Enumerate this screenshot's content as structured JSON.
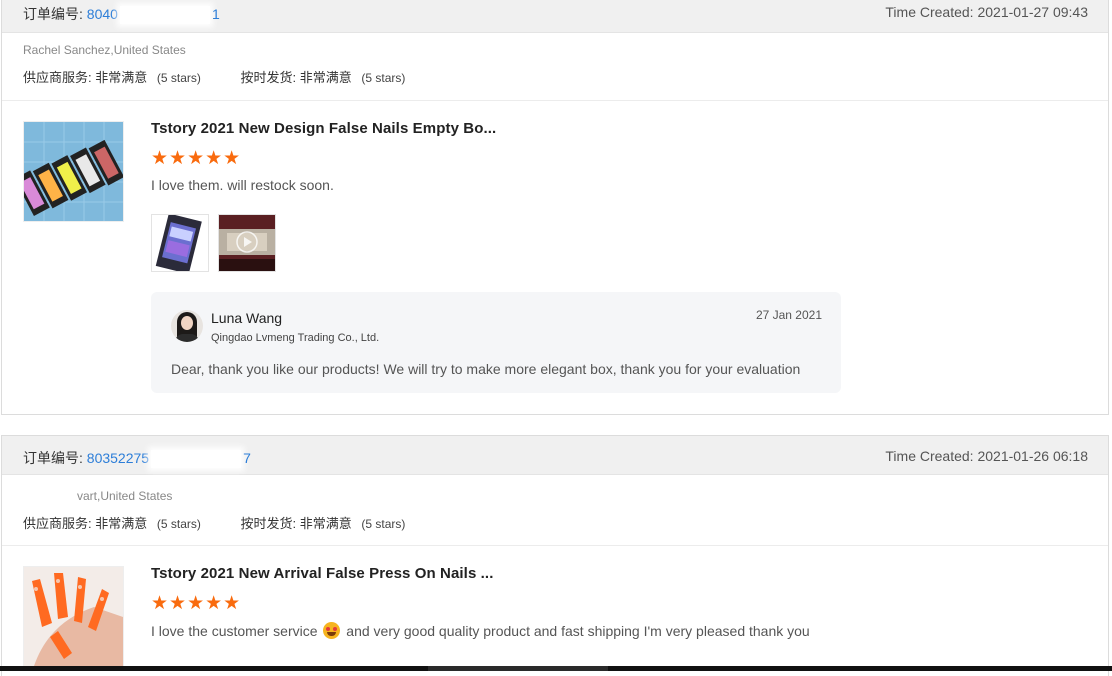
{
  "orders": [
    {
      "order_label": "订单编号:",
      "order_no_start": "8040",
      "order_no_end": "1",
      "time_created": "Time Created: 2021-01-27 09:43",
      "buyer_location": "Rachel Sanchez,United States",
      "supplier_service_label": "供应商服务:",
      "supplier_service_value": "非常满意",
      "supplier_service_stars": "(5 stars)",
      "ontime_label": "按时发货:",
      "ontime_value": "非常满意",
      "ontime_stars": "(5 stars)",
      "product_title": "Tstory 2021 New Design False Nails Empty Bo...",
      "rating": 5,
      "stars_text": "★★★★★",
      "review_text": "I love them. will restock soon.",
      "reply": {
        "seller_name": "Luna Wang",
        "company": "Qingdao Lvmeng Trading Co., Ltd.",
        "date": "27 Jan 2021",
        "text": "Dear, thank you like our products! We will try to make more elegant box, thank you for your evaluation"
      }
    },
    {
      "order_label": "订单编号:",
      "order_no_start": "80352275",
      "order_no_end": "7",
      "time_created": "Time Created: 2021-01-26 06:18",
      "buyer_location": "vart,United States",
      "supplier_service_label": "供应商服务:",
      "supplier_service_value": "非常满意",
      "supplier_service_stars": "(5 stars)",
      "ontime_label": "按时发货:",
      "ontime_value": "非常满意",
      "ontime_stars": "(5 stars)",
      "product_title": "Tstory 2021 New Arrival False Press On Nails ...",
      "rating": 5,
      "stars_text": "★★★★★",
      "review_text_before": "I love the customer service",
      "review_emoji": "star-struck-emoji",
      "review_text_after": "and very good quality product and fast shipping I'm very pleased thank you"
    }
  ],
  "colors": {
    "accent_link": "#2d7ed8",
    "star": "#f96b0e",
    "header_bg": "#f0f0f0",
    "reply_bg": "#f5f6f8"
  }
}
